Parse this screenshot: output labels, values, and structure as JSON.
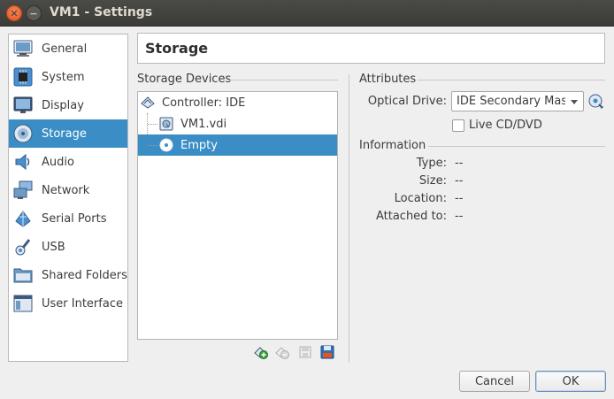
{
  "window": {
    "title": "VM1 - Settings"
  },
  "sidebar": {
    "items": [
      {
        "label": "General",
        "icon": "general-icon"
      },
      {
        "label": "System",
        "icon": "chip-icon"
      },
      {
        "label": "Display",
        "icon": "monitor-icon"
      },
      {
        "label": "Storage",
        "icon": "disk-icon",
        "active": true
      },
      {
        "label": "Audio",
        "icon": "speaker-icon"
      },
      {
        "label": "Network",
        "icon": "network-icon"
      },
      {
        "label": "Serial Ports",
        "icon": "serial-port-icon"
      },
      {
        "label": "USB",
        "icon": "usb-icon"
      },
      {
        "label": "Shared Folders",
        "icon": "folder-icon"
      },
      {
        "label": "User Interface",
        "icon": "window-icon"
      }
    ]
  },
  "page": {
    "title": "Storage"
  },
  "storage_devices": {
    "label": "Storage Devices",
    "controller": "Controller: IDE",
    "items": [
      {
        "label": "VM1.vdi",
        "icon": "hard-disk-icon"
      },
      {
        "label": "Empty",
        "icon": "optical-disc-icon",
        "selected": true
      }
    ]
  },
  "attributes": {
    "label": "Attributes",
    "optical_drive_label": "Optical Drive:",
    "optical_drive_value": "IDE Secondary Master",
    "live_cd_label": "Live CD/DVD",
    "live_cd_checked": false
  },
  "information": {
    "label": "Information",
    "rows": [
      {
        "label": "Type:",
        "value": "--"
      },
      {
        "label": "Size:",
        "value": "--"
      },
      {
        "label": "Location:",
        "value": "--"
      },
      {
        "label": "Attached to:",
        "value": "--"
      }
    ]
  },
  "buttons": {
    "cancel": "Cancel",
    "ok": "OK"
  },
  "colors": {
    "selection": "#3b8ec5",
    "titlebar": "#3c3b37",
    "close_button": "#e0541e"
  }
}
